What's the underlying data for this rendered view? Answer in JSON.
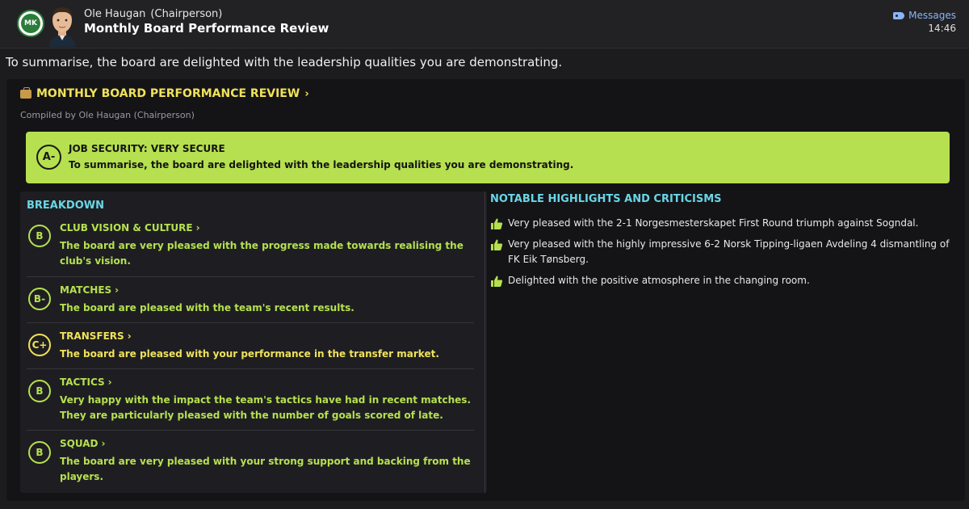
{
  "header": {
    "club_badge_text": "MK",
    "sender_name": "Ole Haugan",
    "sender_role": "(Chairperson)",
    "subject": "Monthly Board Performance Review",
    "messages_label": "Messages",
    "time": "14:46"
  },
  "intro_text": "To summarise, the board are delighted with the leadership qualities you are demonstrating.",
  "review": {
    "title": "MONTHLY BOARD PERFORMANCE REVIEW",
    "compiled_by": "Compiled by Ole Haugan (Chairperson)",
    "job_security": {
      "grade": "A-",
      "title": "JOB SECURITY: VERY SECURE",
      "text": "To summarise, the board are delighted with the leadership qualities you are demonstrating."
    },
    "breakdown_title": "BREAKDOWN",
    "breakdown": [
      {
        "grade": "B",
        "label": "CLUB VISION & CULTURE",
        "text": "The board are very pleased with the progress made towards realising the club's vision."
      },
      {
        "grade": "B-",
        "label": "MATCHES",
        "text": "The board are pleased with the team's recent results."
      },
      {
        "grade": "C+",
        "label": "TRANSFERS",
        "text": "The board are pleased with your performance in the transfer market."
      },
      {
        "grade": "B",
        "label": "TACTICS",
        "text": "Very happy with the impact the team's tactics have had in recent matches. They are particularly pleased with the number of goals scored of late."
      },
      {
        "grade": "B",
        "label": "SQUAD",
        "text": "The board are very pleased with your strong support and backing from the players."
      }
    ],
    "highlights_title": "NOTABLE HIGHLIGHTS AND CRITICISMS",
    "highlights": [
      "Very pleased with the 2-1 Norgesmesterskapet First Round triumph against Sogndal.",
      "Very pleased with the highly impressive 6-2 Norsk Tipping-ligaen Avdeling 4 dismantling of FK Eik Tønsberg.",
      "Delighted with the positive atmosphere in the changing room."
    ]
  },
  "colors": {
    "accent_green": "#b6e04f",
    "accent_yellow": "#f0e25a",
    "accent_cyan": "#69d6e6",
    "link_blue": "#8ab4f8"
  }
}
